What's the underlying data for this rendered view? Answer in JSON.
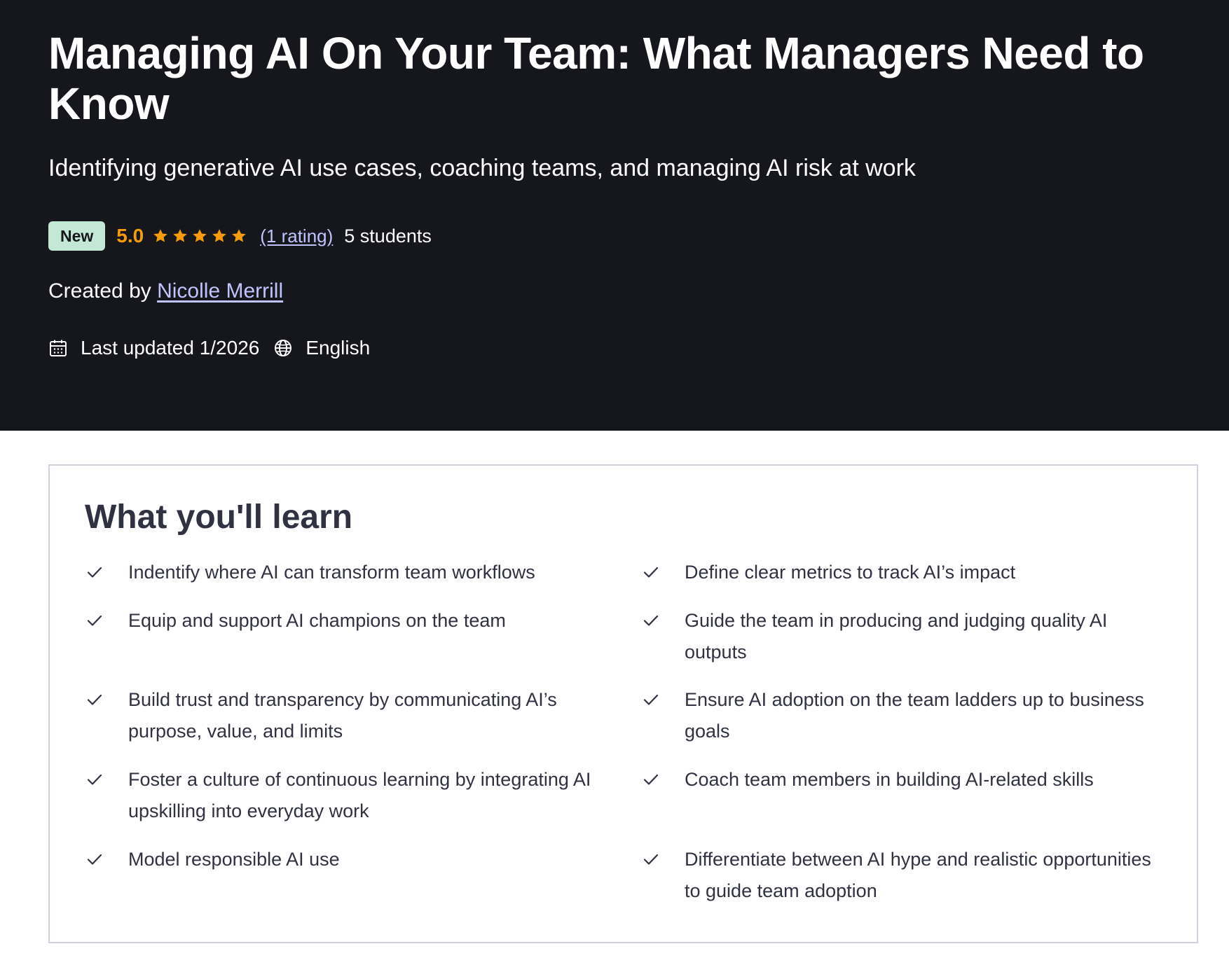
{
  "hero": {
    "title": "Managing AI On Your Team: What Managers Need to Know",
    "subtitle": "Identifying generative AI use cases, coaching teams, and managing AI risk at work",
    "badge": "New",
    "rating": "5.0",
    "stars": 5,
    "rating_link": "(1 rating)",
    "students": "5 students",
    "created_by_label": "Created by",
    "author": "Nicolle Merrill",
    "last_updated": "Last updated 1/2026",
    "language": "English",
    "icons": {
      "calendar": "calendar-icon",
      "globe": "globe-icon",
      "star": "star-icon"
    }
  },
  "learn": {
    "heading": "What you'll learn",
    "left_items": [
      "Indentify where AI can transform team workflows",
      "Equip and support AI champions on the team",
      "Build trust and transparency by communicating AI’s purpose, value, and limits",
      "Foster a culture of continuous learning by integrating AI upskilling into everyday work",
      "Model responsible AI use"
    ],
    "right_items": [
      "Define clear metrics to track AI’s impact",
      "Guide the team in producing and judging quality AI outputs",
      "Ensure AI adoption on the team ladders up to business goals",
      "Coach team members in building AI-related skills",
      "Differentiate between AI hype and realistic opportunities to guide team adoption"
    ],
    "icons": {
      "check": "check-icon"
    }
  },
  "colors": {
    "hero_bg": "#16161d",
    "badge_bg": "#c3e9d6",
    "rating": "#f69c08",
    "link": "#c0c4fc",
    "box_border": "#d1d2e0",
    "text_dark": "#303141"
  }
}
